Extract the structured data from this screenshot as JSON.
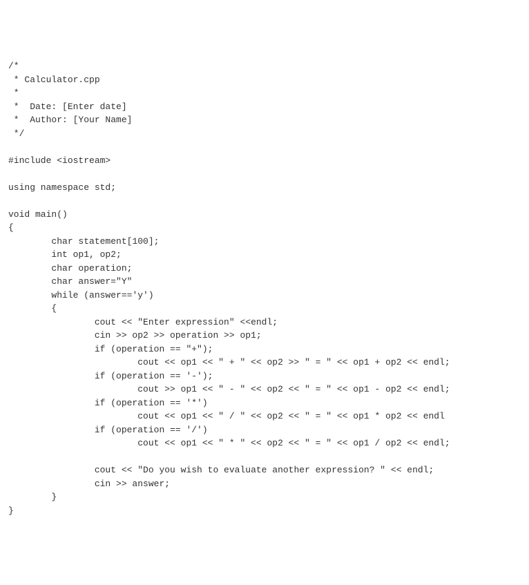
{
  "code": {
    "lines": [
      "/*",
      " * Calculator.cpp",
      " *",
      " *  Date: [Enter date]",
      " *  Author: [Your Name]",
      " */",
      "",
      "#include <iostream>",
      "",
      "using namespace std;",
      "",
      "void main()",
      "{",
      "\tchar statement[100];",
      "\tint op1, op2;",
      "\tchar operation;",
      "\tchar answer=\"Y\"",
      "\twhile (answer=='y')",
      "\t{",
      "\t\tcout << \"Enter expression\" <<endl;",
      "\t\tcin >> op2 >> operation >> op1;",
      "\t\tif (operation == \"+\");",
      "\t\t\tcout << op1 << \" + \" << op2 >> \" = \" << op1 + op2 << endl;",
      "\t\tif (operation == '-');",
      "\t\t\tcout >> op1 << \" - \" << op2 << \" = \" << op1 - op2 << endl;",
      "\t\tif (operation == '*')",
      "\t\t\tcout << op1 << \" / \" << op2 << \" = \" << op1 * op2 << endl",
      "\t\tif (operation == '/')",
      "\t\t\tcout << op1 << \" * \" << op2 << \" = \" << op1 / op2 << endl;",
      "",
      "\t\tcout << \"Do you wish to evaluate another expression? \" << endl;",
      "\t\tcin >> answer;",
      "\t}",
      "}",
      ""
    ]
  }
}
